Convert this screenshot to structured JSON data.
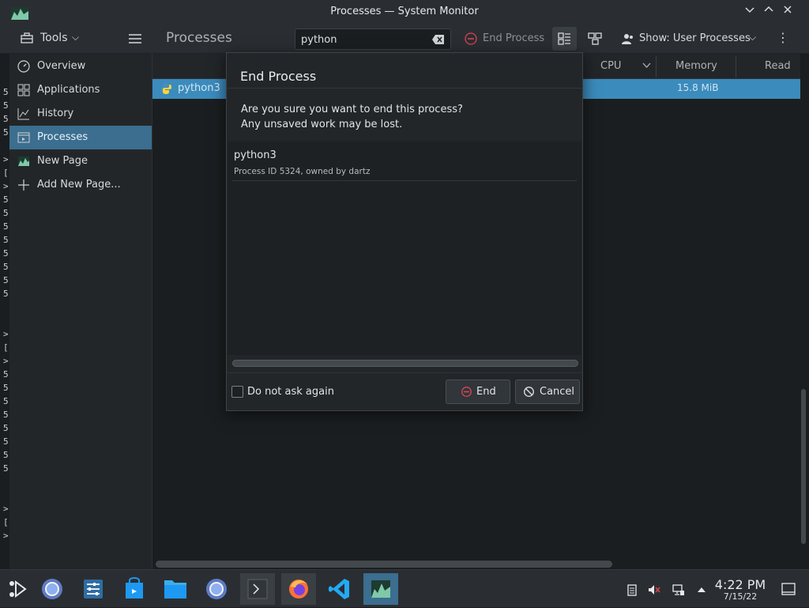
{
  "window": {
    "title": "Processes — System Monitor"
  },
  "toolbar": {
    "tools_label": "Tools",
    "page_title": "Processes",
    "search_value": "python",
    "end_process_label": "End Process",
    "show_label": "Show: User Processes"
  },
  "sidebar": {
    "items": [
      {
        "label": "Overview",
        "icon": "gauge-icon"
      },
      {
        "label": "Applications",
        "icon": "grid-icon"
      },
      {
        "label": "History",
        "icon": "chart-icon"
      },
      {
        "label": "Processes",
        "icon": "processes-icon"
      },
      {
        "label": "New Page",
        "icon": "page-icon"
      },
      {
        "label": "Add New Page...",
        "icon": "plus-icon"
      }
    ]
  },
  "table": {
    "columns": [
      "CPU",
      "Memory",
      "Read"
    ],
    "rows": [
      {
        "name": "python3",
        "memory": "15.8 MiB"
      }
    ]
  },
  "terminal_chars": [
    "5",
    "5",
    "5",
    "5",
    ">",
    "[",
    ">",
    "5",
    "5",
    "5",
    "5",
    "5",
    "5",
    "5",
    "5",
    ">",
    "[",
    ">",
    "5",
    "5",
    "5",
    "5",
    "5",
    "5",
    "5",
    "5",
    ">",
    "[",
    ">"
  ],
  "dialog": {
    "title": "End Process",
    "message_line1": "Are you sure you want to end this process?",
    "message_line2": "Any unsaved work may be lost.",
    "process_name": "python3",
    "process_detail": "Process ID 5324, owned by dartz",
    "checkbox_label": "Do not ask again",
    "end_label": "End",
    "cancel_label": "Cancel"
  },
  "taskbar": {
    "time": "4:22 PM",
    "date": "7/15/22"
  },
  "colors": {
    "accent": "#3b8bbd",
    "sidebar_active": "#3b6e8f",
    "danger": "#da4453"
  }
}
